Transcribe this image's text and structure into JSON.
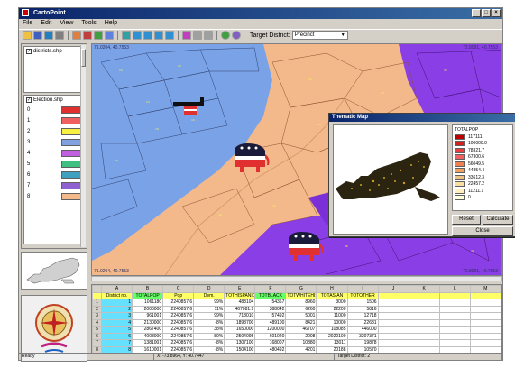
{
  "window": {
    "title": "CartoPoint"
  },
  "menu": [
    "File",
    "Edit",
    "View",
    "Tools",
    "Help"
  ],
  "toolbar": {
    "target_label": "Target District:",
    "target_value": "Precinct"
  },
  "left_panel": {
    "layer1": {
      "label": "districts.shp",
      "checked": true
    },
    "layer2": {
      "label": "Election.shp",
      "checked": true,
      "legend": [
        {
          "num": "0",
          "color": "#e03030"
        },
        {
          "num": "1",
          "color": "#f06060"
        },
        {
          "num": "2",
          "color": "#f8f040"
        },
        {
          "num": "3",
          "color": "#80a0e0"
        },
        {
          "num": "4",
          "color": "#c060e0"
        },
        {
          "num": "5",
          "color": "#40c080"
        },
        {
          "num": "6",
          "color": "#40a0c0"
        },
        {
          "num": "7",
          "color": "#9060d0"
        },
        {
          "num": "8",
          "color": "#f4b98a"
        }
      ]
    }
  },
  "map": {
    "coord_tl": "71.0204, 40.7553",
    "coord_tr": "72.8091, 40.7553",
    "coord_bl": "71.0204, 40.7553",
    "coord_br": "72.8091, 40.7553",
    "colors": {
      "orange": "#f4b98a",
      "blue": "#7aa2e6",
      "purple": "#8a3ee6",
      "red": "#e03030"
    }
  },
  "dialog": {
    "title": "Thematic Map",
    "legend_title": "TOTALPOP",
    "legend": [
      {
        "label": "117111",
        "color": "#c00000"
      },
      {
        "label": "100000.0",
        "color": "#d82020"
      },
      {
        "label": "78321.7",
        "color": "#e84040"
      },
      {
        "label": "67300.6",
        "color": "#f06060"
      },
      {
        "label": "56049.5",
        "color": "#f08050"
      },
      {
        "label": "44854.4",
        "color": "#f0a060"
      },
      {
        "label": "33612.3",
        "color": "#f0c080"
      },
      {
        "label": "22457.2",
        "color": "#f8e0a0"
      },
      {
        "label": "11211.1",
        "color": "#fff0c0"
      },
      {
        "label": "0",
        "color": "#ffffe0"
      }
    ],
    "btn_reset": "Reset",
    "btn_calculate": "Calculate",
    "btn_close": "Close"
  },
  "sheet": {
    "col_letters": [
      "",
      "A",
      "B",
      "C",
      "D",
      "E",
      "F",
      "G",
      "H",
      "I",
      "J",
      "K",
      "L",
      "M"
    ],
    "headers": [
      "District no.",
      "TOTALPOP",
      "Pop",
      "Dem.",
      "TOTHISPANIC",
      "TOTBLACK",
      "TOTWHITEHISP",
      "TOTASIAN",
      "TOTOTHER",
      "",
      "",
      "",
      ""
    ],
    "rows": [
      [
        "1",
        "1",
        "1061180",
        "2240857.6",
        "99%",
        "488104",
        "54367",
        "8960",
        "3000",
        "1506",
        "",
        "",
        ""
      ],
      [
        "2",
        "2",
        "2000000",
        "2240857.6",
        "11%",
        "467081.9",
        "388042",
        "6260",
        "22200",
        "5816",
        "",
        "",
        ""
      ],
      [
        "3",
        "3",
        "961001",
        "2240857.6",
        "99%",
        "718010",
        "57492",
        "5001",
        "11000",
        "12718",
        "",
        "",
        ""
      ],
      [
        "4",
        "4",
        "2130000",
        "2240857.6",
        "-8%",
        "1898700",
        "489100",
        "8421",
        "10000",
        "22681",
        "",
        "",
        ""
      ],
      [
        "5",
        "5",
        "2867400",
        "2240857.6",
        "38%",
        "1650000",
        "1200000",
        "46707",
        "108085",
        "446000",
        "",
        "",
        ""
      ],
      [
        "6",
        "6",
        "4008000",
        "2240857.6",
        "80%",
        "2504095",
        "601020",
        "2008",
        "2020100",
        "3207371",
        "",
        "",
        ""
      ],
      [
        "7",
        "7",
        "1381001",
        "2240857.6",
        "-8%",
        "1307100",
        "168007",
        "10880",
        "13011",
        "19878",
        "",
        "",
        ""
      ],
      [
        "8",
        "8",
        "1610001",
        "2240857.6",
        "-8%",
        "1504100",
        "480492",
        "4201",
        "20188",
        "10570",
        "",
        "",
        ""
      ]
    ]
  },
  "status": {
    "left": "Ready",
    "middle": "X: -73.8964, Y: 40.7447",
    "right": "Target District: 2"
  }
}
